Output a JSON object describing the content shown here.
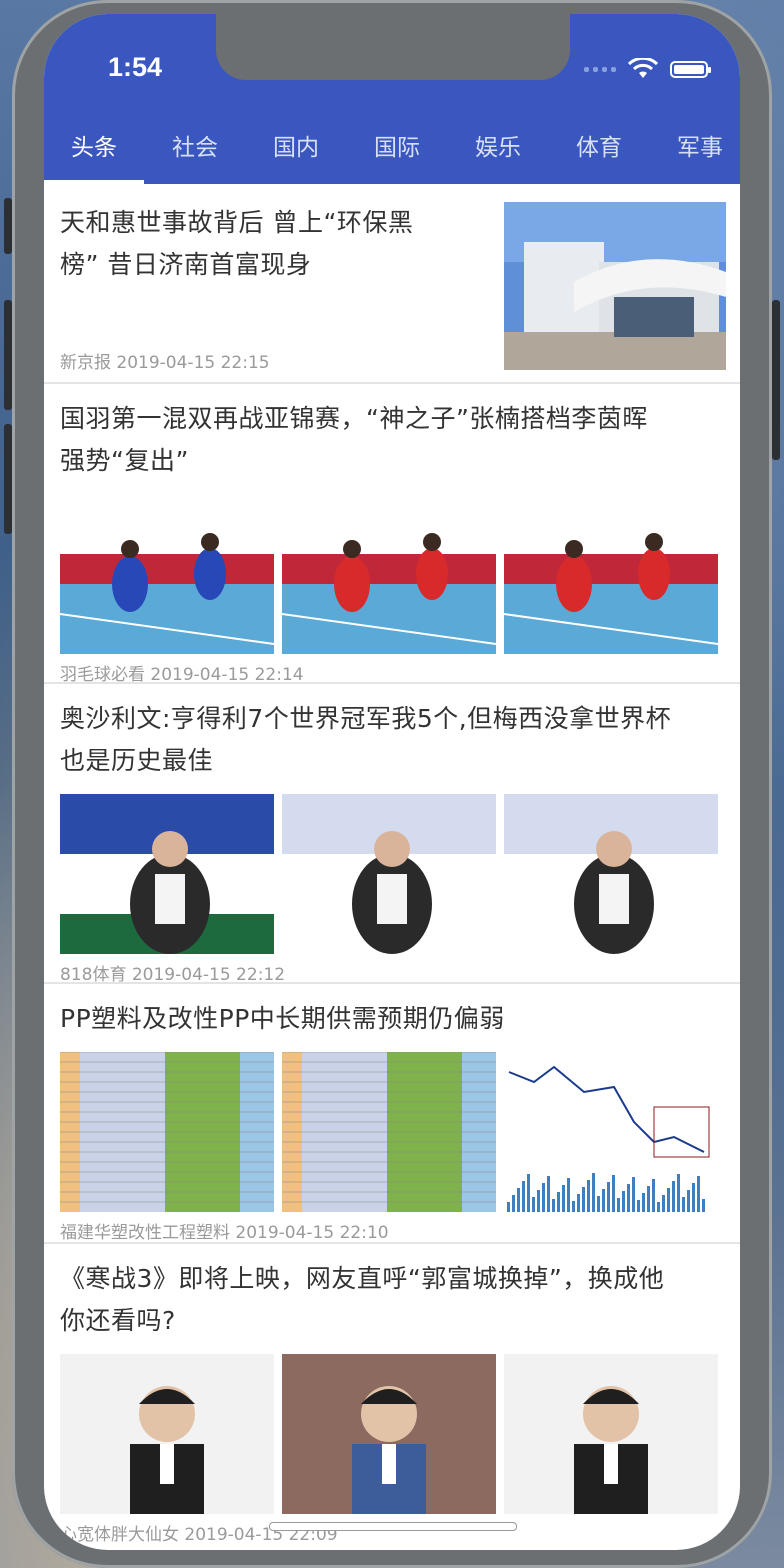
{
  "status_bar": {
    "time": "1:54"
  },
  "tabs": [
    "头条",
    "社会",
    "国内",
    "国际",
    "娱乐",
    "体育",
    "军事"
  ],
  "active_tab_index": 0,
  "articles": [
    {
      "title_lines": [
        "天和惠世事故背后 曾上“环保黑",
        "榜” 昔日济南首富现身"
      ],
      "source": "新京报",
      "time": "2019-04-15 22:15",
      "images": [
        "building-photo"
      ]
    },
    {
      "title_lines": [
        "国羽第一混双再战亚锦赛，“神之子”张楠搭档李茵晖",
        "强势“复出”"
      ],
      "source": "羽毛球必看",
      "time": "2019-04-15 22:14",
      "images": [
        "badminton-photo-1",
        "badminton-photo-2",
        "badminton-photo-3"
      ]
    },
    {
      "title_lines": [
        "奥沙利文:亨得利7个世界冠军我5个,但梅西没拿世界杯",
        "也是历史最佳"
      ],
      "source": "818体育",
      "time": "2019-04-15 22:12",
      "images": [
        "snooker-photo-1",
        "snooker-photo-2",
        "snooker-photo-3"
      ]
    },
    {
      "title_lines": [
        "PP塑料及改性PP中长期供需预期仍偏弱"
      ],
      "source": "福建华塑改性工程塑料",
      "time": "2019-04-15 22:10",
      "images": [
        "spreadsheet-image-1",
        "spreadsheet-image-2",
        "stock-chart-image"
      ]
    },
    {
      "title_lines": [
        "《寒战3》即将上映，网友直呼“郭富城换掉”，换成他",
        "你还看吗?"
      ],
      "source": "心宽体胖大仙女",
      "time": "2019-04-15 22:09",
      "images": [
        "actor-photo-1",
        "actor-photo-2",
        "actor-photo-3"
      ]
    }
  ],
  "colors": {
    "header_blue": "#3a56bf",
    "title_text": "#333333",
    "meta_text": "#9a9a9a"
  }
}
